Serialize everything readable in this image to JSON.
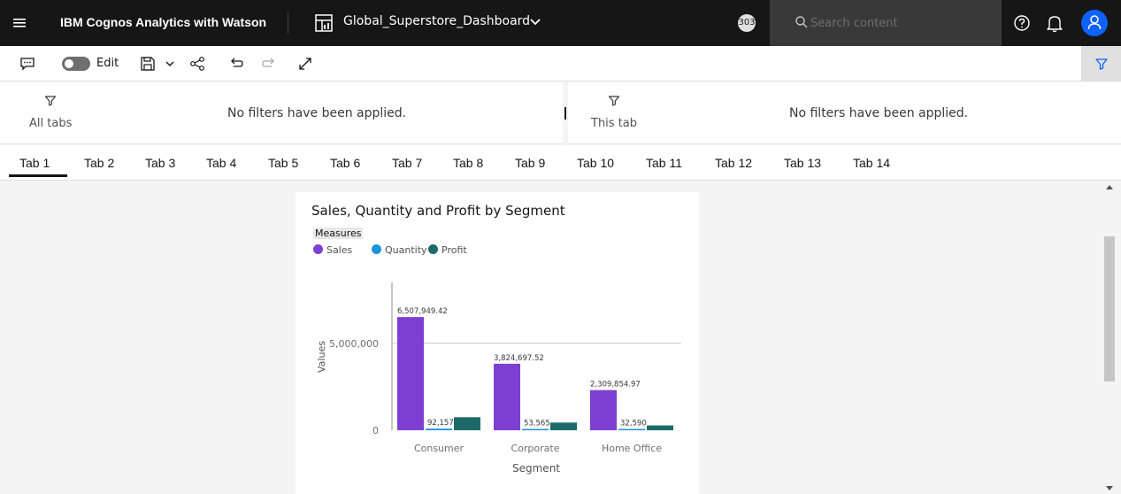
{
  "topbar": {
    "app_title": "IBM Cognos Analytics with Watson",
    "dashboard_title": "Global_Superstore_Dashboard",
    "badge_count": "303",
    "search_placeholder": "Search content",
    "icons": [
      "menu-icon",
      "dashboard-icon",
      "chevron-down-icon",
      "search-icon",
      "help-icon",
      "notification-bell-icon",
      "user-avatar-icon"
    ]
  },
  "toolbar": {
    "edit_label": "Edit",
    "icons": [
      "comment-icon",
      "save-icon",
      "chevron-down-icon",
      "share-icon",
      "undo-icon",
      "redo-icon",
      "expand-icon",
      "filter-icon"
    ]
  },
  "filters": {
    "all_tabs": {
      "label": "All tabs",
      "message": "No filters have been applied."
    },
    "this_tab": {
      "label": "This tab",
      "message": "No filters have been applied."
    }
  },
  "tabs": [
    "Tab 1",
    "Tab 2",
    "Tab 3",
    "Tab 4",
    "Tab 5",
    "Tab 6",
    "Tab 7",
    "Tab 8",
    "Tab 9",
    "Tab 10",
    "Tab 11",
    "Tab 12",
    "Tab 13",
    "Tab 14"
  ],
  "active_tab": "Tab 1",
  "colors": {
    "sales": "#7d3fd1",
    "quantity": "#1f92dc",
    "profit": "#1c6b6a",
    "topbar": "#161616",
    "accent": "#0f62fe"
  },
  "chart_data": {
    "type": "bar",
    "title": "Sales, Quantity and Profit by Segment",
    "legend_title": "Measures",
    "xlabel": "Segment",
    "ylabel": "Values",
    "categories": [
      "Consumer",
      "Corporate",
      "Home Office"
    ],
    "series": [
      {
        "name": "Sales",
        "values": [
          6507949.42,
          3824697.52,
          2309854.97
        ],
        "labels": [
          "6,507,949.42",
          "3,824,697.52",
          "2,309,854.97"
        ]
      },
      {
        "name": "Quantity",
        "values": [
          92157,
          53565,
          32590
        ],
        "labels": [
          "92,157",
          "53,565",
          "32,590"
        ]
      },
      {
        "name": "Profit",
        "values": [
          749240,
          442000,
          277000
        ]
      }
    ],
    "y_ticks": [
      {
        "value": 0,
        "label": "0"
      },
      {
        "value": 5000000,
        "label": "5,000,000"
      }
    ],
    "ylim": [
      0,
      8500000
    ],
    "legend_position": "top-left",
    "grid": true
  }
}
